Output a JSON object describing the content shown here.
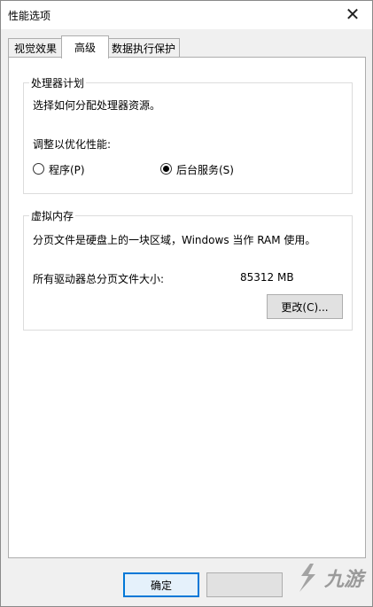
{
  "window": {
    "title": "性能选项",
    "close_glyph": "✕"
  },
  "tabs": [
    {
      "label": "视觉效果",
      "active": false
    },
    {
      "label": "高级",
      "active": true
    },
    {
      "label": "数据执行保护",
      "active": false
    }
  ],
  "processor": {
    "group_title": "处理器计划",
    "description": "选择如何分配处理器资源。",
    "optimize_label": "调整以优化性能:",
    "option_programs": "程序(P)",
    "option_services": "后台服务(S)",
    "selected": "services"
  },
  "virtual_memory": {
    "group_title": "虚拟内存",
    "description": "分页文件是硬盘上的一块区域，Windows 当作 RAM 使用。",
    "total_label": "所有驱动器总分页文件大小:",
    "total_value": "85312 MB",
    "change_button": "更改(C)..."
  },
  "footer": {
    "ok_button": "确定"
  },
  "watermark": {
    "text": "九游"
  },
  "colors": {
    "accent": "#0078d7",
    "window_bg": "#f0f0f0",
    "panel_bg": "#ffffff"
  }
}
